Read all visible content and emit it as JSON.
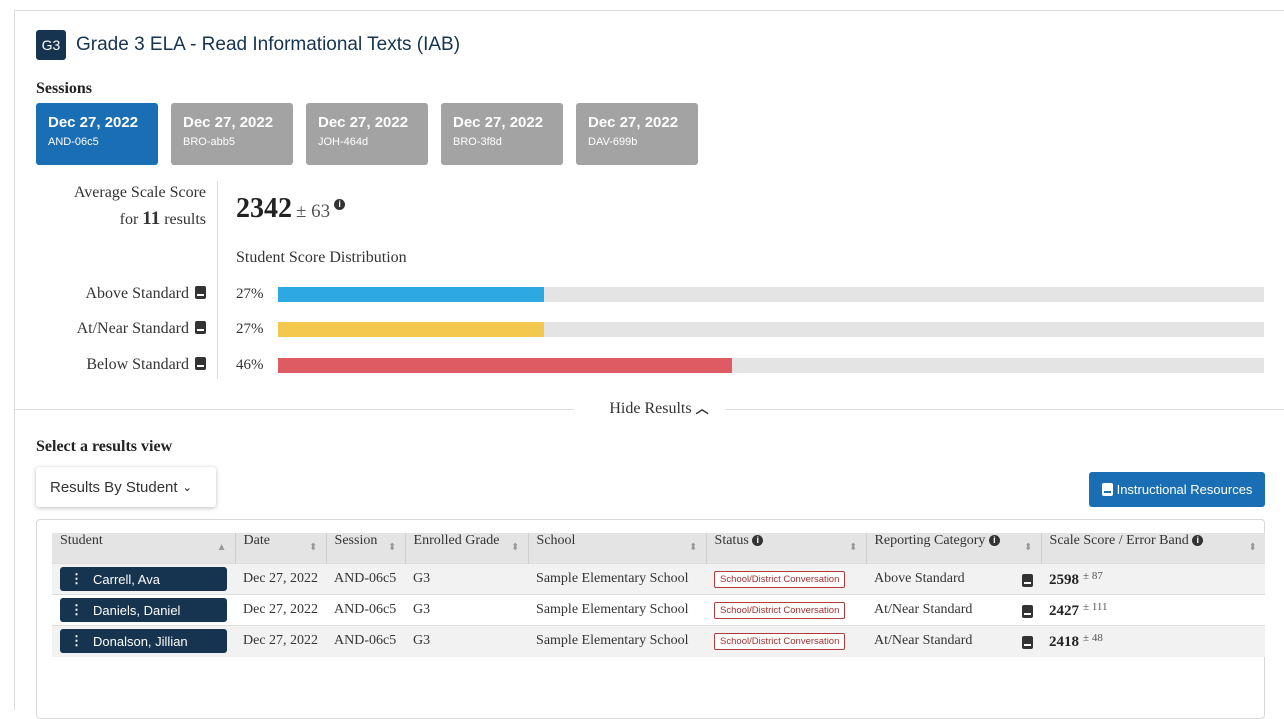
{
  "header": {
    "grade_badge": "G3",
    "title": "Grade 3 ELA - Read Informational Texts (IAB)"
  },
  "sessions": {
    "label": "Sessions",
    "tabs": [
      {
        "date": "Dec 27, 2022",
        "code": "AND-06c5",
        "active": true
      },
      {
        "date": "Dec 27, 2022",
        "code": "BRO-abb5",
        "active": false
      },
      {
        "date": "Dec 27, 2022",
        "code": "JOH-464d",
        "active": false
      },
      {
        "date": "Dec 27, 2022",
        "code": "BRO-3f8d",
        "active": false
      },
      {
        "date": "Dec 27, 2022",
        "code": "DAV-699b",
        "active": false
      }
    ]
  },
  "summary": {
    "avg_label_line1": "Average Scale Score",
    "avg_label_for": "for",
    "result_count": "11",
    "avg_label_results": "results",
    "score": "2342",
    "error_band": "± 63",
    "info_icon": "i",
    "distribution_title": "Student Score Distribution",
    "categories": [
      {
        "label": "Above Standard",
        "percent": "27%",
        "value": 0.27,
        "color": "#2ea8e0"
      },
      {
        "label": "At/Near Standard",
        "percent": "27%",
        "value": 0.27,
        "color": "#f2c94c"
      },
      {
        "label": "Below Standard",
        "percent": "46%",
        "value": 0.46,
        "color": "#df5b64"
      }
    ]
  },
  "hide_results": "Hide Results",
  "results_view": {
    "label": "Select a results view",
    "selected": "Results By Student",
    "instructional_button": "Instructional Resources"
  },
  "table": {
    "columns": [
      "Student",
      "Date",
      "Session",
      "Enrolled Grade",
      "School",
      "Status",
      "Reporting Category",
      "Scale Score / Error Band"
    ],
    "rows": [
      {
        "student": "Carrell, Ava",
        "date": "Dec 27, 2022",
        "session": "AND-06c5",
        "grade": "G3",
        "school": "Sample Elementary School",
        "status": "School/District Conversation",
        "category": "Above Standard",
        "score": "2598",
        "error": "± 87"
      },
      {
        "student": "Daniels, Daniel",
        "date": "Dec 27, 2022",
        "session": "AND-06c5",
        "grade": "G3",
        "school": "Sample Elementary School",
        "status": "School/District Conversation",
        "category": "At/Near Standard",
        "score": "2427",
        "error": "± 111"
      },
      {
        "student": "Donalson, Jillian",
        "date": "Dec 27, 2022",
        "session": "AND-06c5",
        "grade": "G3",
        "school": "Sample Elementary School",
        "status": "School/District Conversation",
        "category": "At/Near Standard",
        "score": "2418",
        "error": "± 48"
      }
    ]
  }
}
